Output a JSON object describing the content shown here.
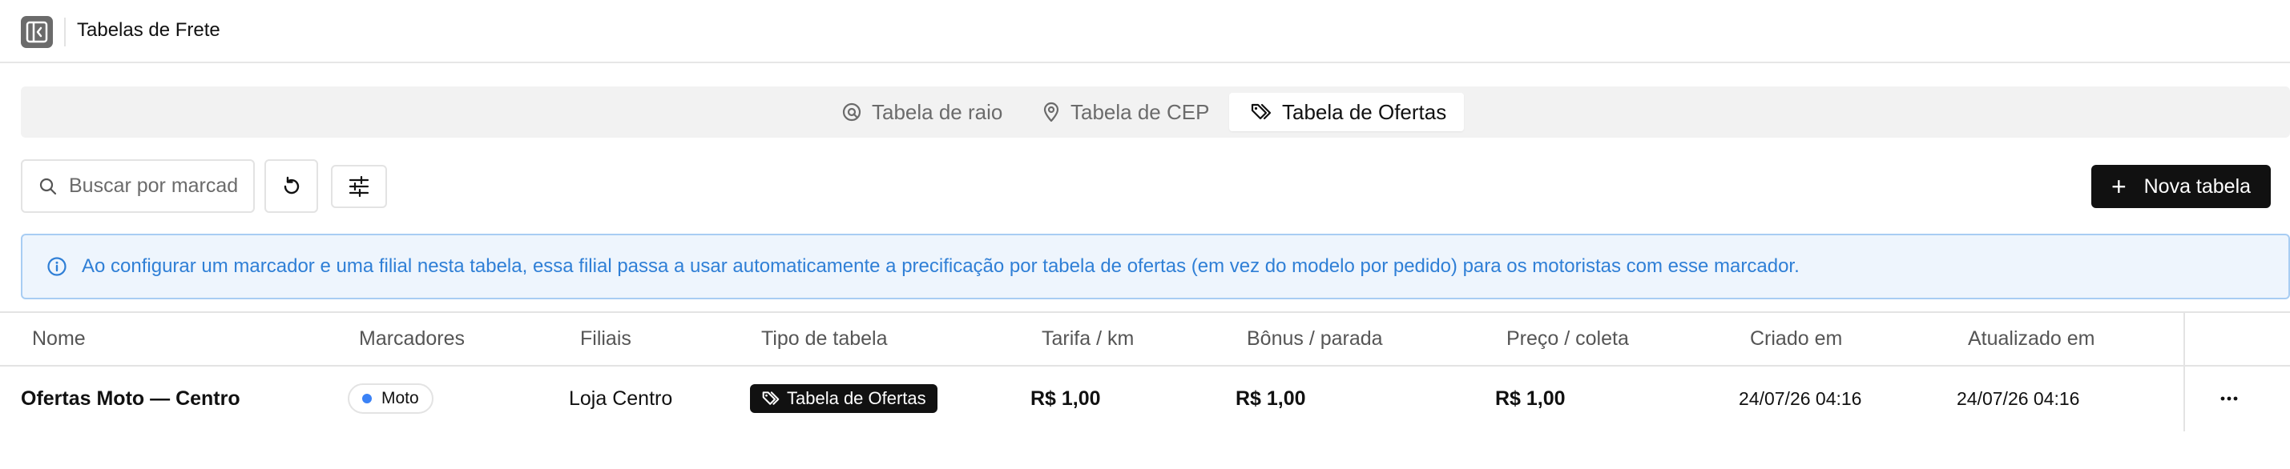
{
  "header": {
    "sidebar_toggle_icon": "sidebar-panel-icon",
    "title": "Tabelas de Frete"
  },
  "tabs": [
    {
      "label": "Tabela de raio",
      "icon": "radius-target-icon",
      "active": false
    },
    {
      "label": "Tabela de CEP",
      "icon": "map-pin-icon",
      "active": false
    },
    {
      "label": "Tabela de Ofertas",
      "icon": "tags-icon",
      "active": true
    }
  ],
  "toolbar": {
    "search_placeholder": "Buscar por marcador",
    "reset_icon": "rotate-ccw-icon",
    "filter_icon": "sliders-icon",
    "new_table_label": "Nova tabela",
    "new_table_icon": "plus-icon"
  },
  "banner": {
    "icon": "info-icon",
    "text": "Ao configurar um marcador e uma filial nesta tabela, essa filial passa a usar automaticamente a precificação por tabela de ofertas (em vez do modelo por pedido) para os motoristas com esse marcador."
  },
  "table": {
    "columns": [
      "Nome",
      "Marcadores",
      "Filiais",
      "Tipo de tabela",
      "Tarifa / km",
      "Bônus / parada",
      "Preço / coleta",
      "Criado em",
      "Atualizado em"
    ],
    "rows": [
      {
        "nome": "Ofertas Moto — Centro",
        "marcador": "Moto",
        "marcador_color": "#3b82f6",
        "filial": "Loja Centro",
        "tipo": "Tabela de Ofertas",
        "tarifa_km": "R$ 1,00",
        "bonus_parada": "R$ 1,00",
        "preco_coleta": "R$ 1,00",
        "criado_em": "24/07/26 04:16",
        "atualizado_em": "24/07/26 04:16",
        "actions_icon": "more-horizontal-icon"
      }
    ]
  },
  "colors": {
    "accent_dark": "#111111",
    "info_blue": "#2f7fd6",
    "info_bg": "#eef5fd",
    "tag_dot": "#3b82f6"
  }
}
